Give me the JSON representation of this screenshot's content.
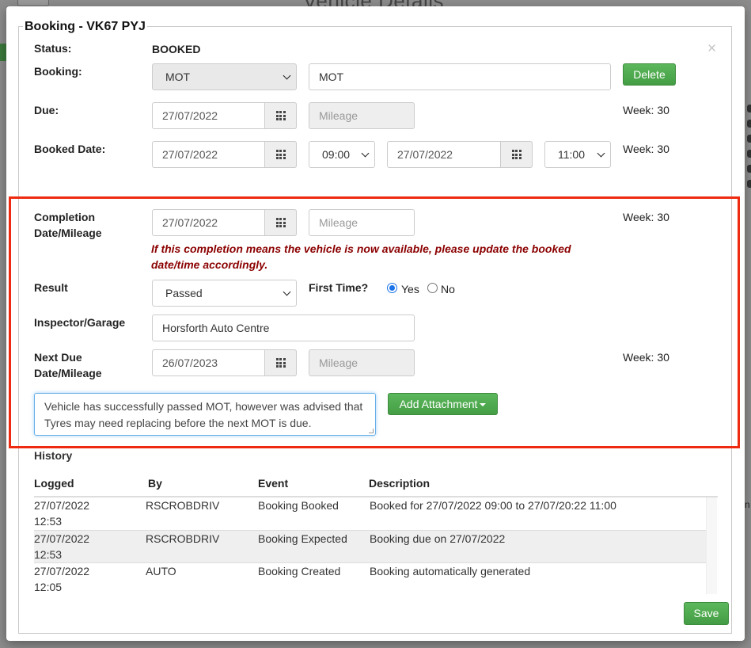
{
  "background": {
    "title": "Vehicle Details",
    "right_text": "n"
  },
  "modal": {
    "legend": "Booking - VK67 PYJ",
    "close_glyph": "×",
    "status": {
      "label": "Status:",
      "value": "BOOKED"
    },
    "booking": {
      "label": "Booking:",
      "type_select": "MOT",
      "description": "MOT",
      "delete_label": "Delete"
    },
    "due": {
      "label": "Due:",
      "date": "27/07/2022",
      "mileage_placeholder": "Mileage",
      "week": "Week: 30"
    },
    "booked_date": {
      "label": "Booked Date:",
      "start_date": "27/07/2022",
      "start_time": "09:00",
      "end_date": "27/07/2022",
      "end_time": "11:00",
      "week": "Week: 30"
    },
    "completion": {
      "label_line1": "Completion",
      "label_line2": "Date/Mileage",
      "date": "27/07/2022",
      "mileage_placeholder": "Mileage",
      "week": "Week: 30",
      "warning_line1": "If this completion means the vehicle is now available, please update the booked",
      "warning_line2": "date/time accordingly."
    },
    "result": {
      "label": "Result",
      "value": "Passed",
      "first_time_label": "First Time?",
      "yes": "Yes",
      "no": "No",
      "selected": "Yes"
    },
    "inspector": {
      "label": "Inspector/Garage",
      "value": "Horsforth Auto Centre"
    },
    "next_due": {
      "label_line1": "Next Due",
      "label_line2": "Date/Mileage",
      "date": "26/07/2023",
      "mileage_placeholder": "Mileage",
      "week": "Week: 30"
    },
    "notes": "Vehicle has successfully passed MOT, however was advised that Tyres may need replacing before the next MOT is due.",
    "add_attachment": "Add Attachment",
    "history": {
      "title": "History",
      "columns": [
        "Logged",
        "By",
        "Event",
        "Description"
      ],
      "rows": [
        {
          "logged_date": "27/07/2022",
          "logged_time": "12:53",
          "by": "RSCROBDRIV",
          "event": "Booking Booked",
          "description": "Booked for 27/07/2022 09:00 to 27/07/20:22 11:00"
        },
        {
          "logged_date": "27/07/2022",
          "logged_time": "12:53",
          "by": "RSCROBDRIV",
          "event": "Booking Expected",
          "description": "Booking due on 27/07/2022"
        },
        {
          "logged_date": "27/07/2022",
          "logged_time": "12:05",
          "by": "AUTO",
          "event": "Booking Created",
          "description": "Booking automatically generated"
        }
      ]
    },
    "save_label": "Save",
    "colors": {
      "success": "#5cb85c",
      "warning_text": "#8b0000",
      "highlight": "#ee2b10",
      "radio": "#1a73e8"
    }
  }
}
